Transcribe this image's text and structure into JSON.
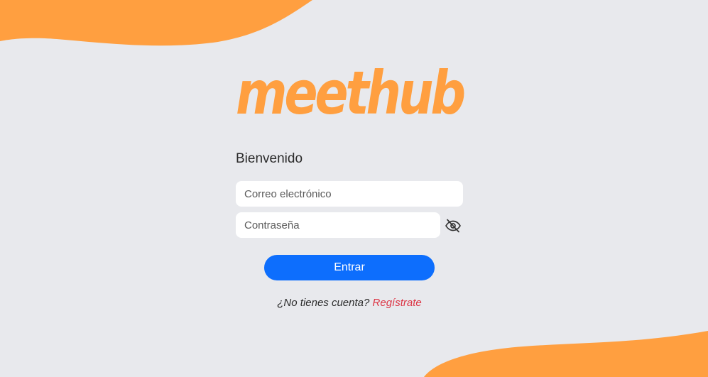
{
  "brand": {
    "logo_text": "meethub",
    "accent_color": "#ff9f40",
    "primary_color": "#0d6efd",
    "link_color": "#dc3545"
  },
  "form": {
    "welcome": "Bienvenido",
    "email_placeholder": "Correo electrónico",
    "password_placeholder": "Contraseña",
    "password_toggle_icon": "eye-slash-icon",
    "submit_label": "Entrar",
    "no_account_text": "¿No tienes cuenta?",
    "register_link": "Regístrate"
  }
}
